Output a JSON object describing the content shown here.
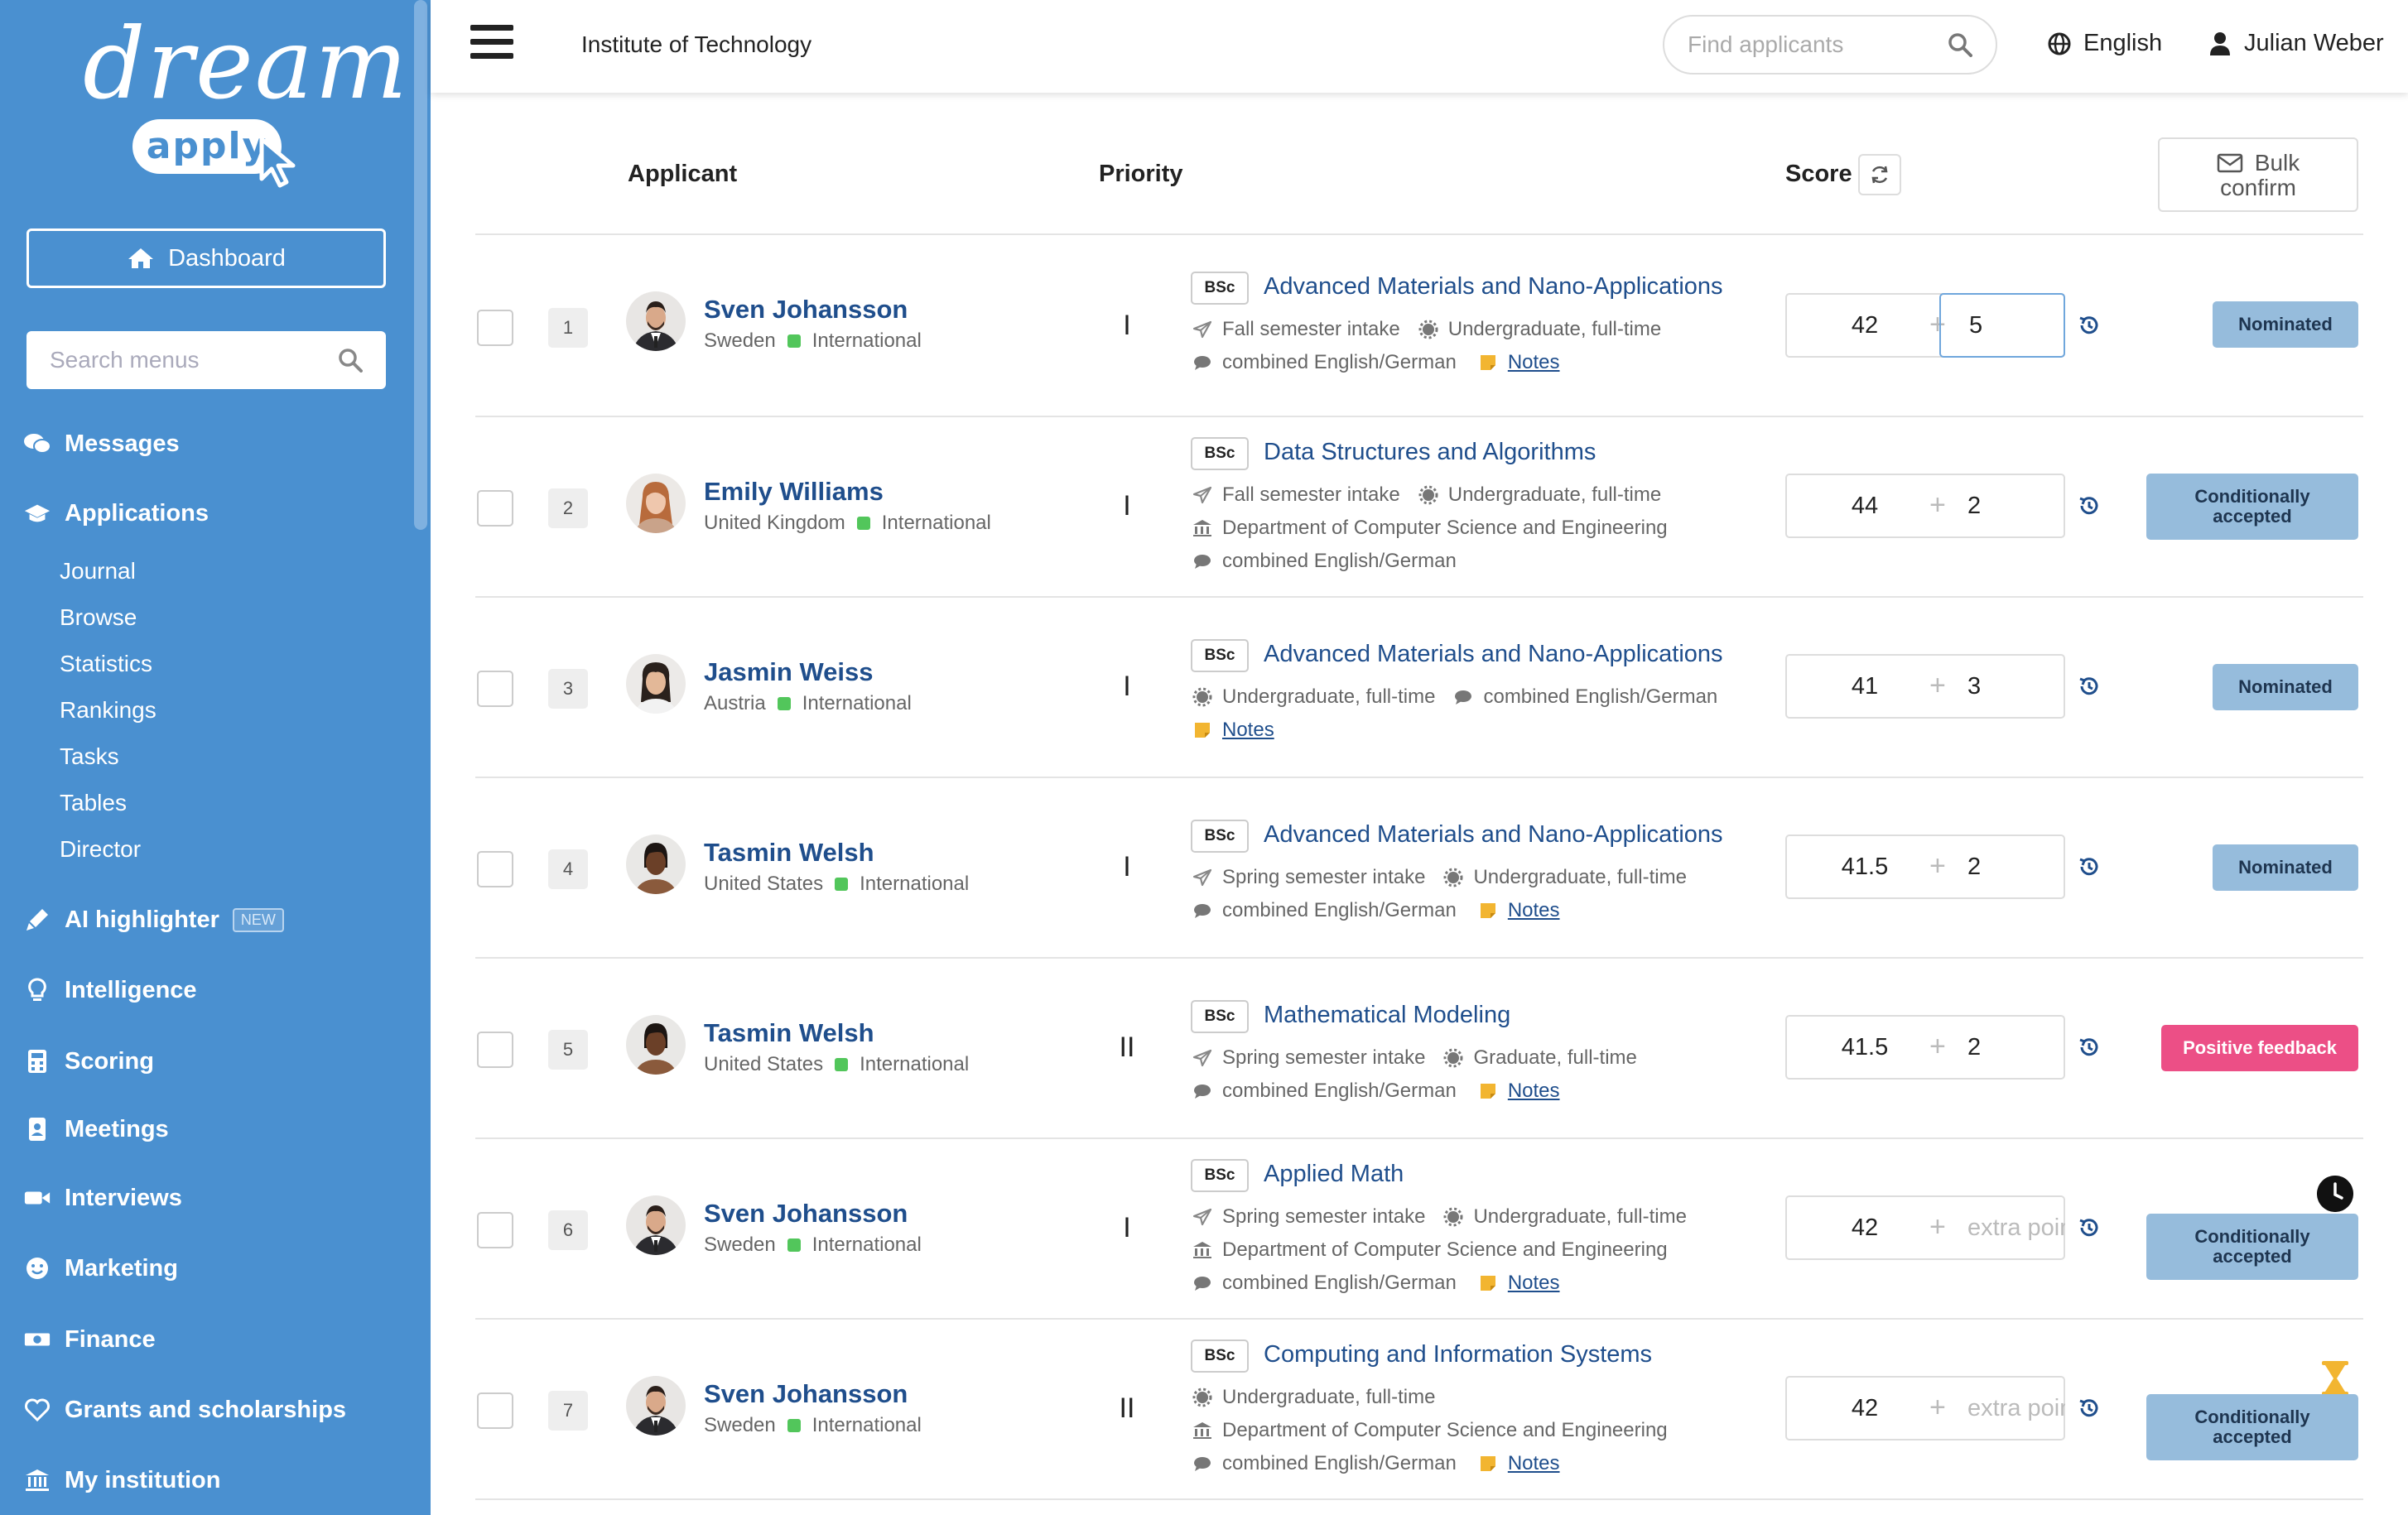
{
  "sidebar": {
    "logo_text": "dream",
    "logo_sub": "apply",
    "dashboard_label": "Dashboard",
    "search_placeholder": "Search menus",
    "nav": {
      "messages": "Messages",
      "applications": "Applications",
      "ai_highlighter": "AI highlighter",
      "ai_badge": "NEW",
      "intelligence": "Intelligence",
      "scoring": "Scoring",
      "meetings": "Meetings",
      "interviews": "Interviews",
      "marketing": "Marketing",
      "finance": "Finance",
      "grants": "Grants and scholarships",
      "institution": "My institution"
    },
    "sub": [
      "Journal",
      "Browse",
      "Statistics",
      "Rankings",
      "Tasks",
      "Tables",
      "Director"
    ]
  },
  "header": {
    "institute": "Institute of Technology",
    "search_placeholder": "Find applicants",
    "language": "English",
    "user": "Julian Weber"
  },
  "table": {
    "col_applicant": "Applicant",
    "col_priority": "Priority",
    "col_score": "Score",
    "bulk_confirm_line1": "Bulk",
    "bulk_confirm_line2": "confirm",
    "extra_placeholder": "extra points",
    "notes_label": "Notes",
    "degree": "BSc"
  },
  "rows": [
    {
      "num": "1",
      "name": "Sven Johansson",
      "country": "Sweden",
      "type": "International",
      "priority": "I",
      "program": "Advanced Materials and Nano-Applications",
      "intake": "Fall semester intake",
      "level": "Undergraduate, full-time",
      "language": "combined English/German",
      "score": "42",
      "extra": "5",
      "status": "Nominated"
    },
    {
      "num": "2",
      "name": "Emily Williams",
      "country": "United Kingdom",
      "type": "International",
      "priority": "I",
      "program": "Data Structures and Algorithms",
      "intake": "Fall semester intake",
      "level": "Undergraduate, full-time",
      "department": "Department of Computer Science and Engineering",
      "language": "combined English/German",
      "score": "44",
      "extra": "2",
      "status_line1": "Conditionally",
      "status_line2": "accepted"
    },
    {
      "num": "3",
      "name": "Jasmin Weiss",
      "country": "Austria",
      "type": "International",
      "priority": "I",
      "program": "Advanced Materials and Nano-Applications",
      "level": "Undergraduate, full-time",
      "language": "combined English/German",
      "score": "41",
      "extra": "3",
      "status": "Nominated"
    },
    {
      "num": "4",
      "name": "Tasmin Welsh",
      "country": "United States",
      "type": "International",
      "priority": "I",
      "program": "Advanced Materials and Nano-Applications",
      "intake": "Spring semester intake",
      "level": "Undergraduate, full-time",
      "language": "combined English/German",
      "score": "41.5",
      "extra": "2",
      "status": "Nominated"
    },
    {
      "num": "5",
      "name": "Tasmin Welsh",
      "country": "United States",
      "type": "International",
      "priority": "II",
      "program": "Mathematical Modeling",
      "intake": "Spring semester intake",
      "level": "Graduate, full-time",
      "language": "combined English/German",
      "score": "41.5",
      "extra": "2",
      "status": "Positive feedback"
    },
    {
      "num": "6",
      "name": "Sven Johansson",
      "country": "Sweden",
      "type": "International",
      "priority": "I",
      "program": "Applied Math",
      "intake": "Spring semester intake",
      "level": "Undergraduate, full-time",
      "department": "Department of Computer Science and Engineering",
      "language": "combined English/German",
      "score": "42",
      "status_line1": "Conditionally",
      "status_line2": "accepted"
    },
    {
      "num": "7",
      "name": "Sven Johansson",
      "country": "Sweden",
      "type": "International",
      "priority": "II",
      "program": "Computing and Information Systems",
      "level": "Undergraduate, full-time",
      "department": "Department of Computer Science and Engineering",
      "language": "combined English/German",
      "score": "42",
      "status_line1": "Conditionally",
      "status_line2": "accepted"
    }
  ],
  "colors": {
    "sidebar": "#4a90d0",
    "link": "#1f4e8c",
    "status_blue": "#96bcdc",
    "status_pink": "#ec4f86",
    "green_dot": "#52c65b",
    "notes_icon": "#f2b531"
  }
}
